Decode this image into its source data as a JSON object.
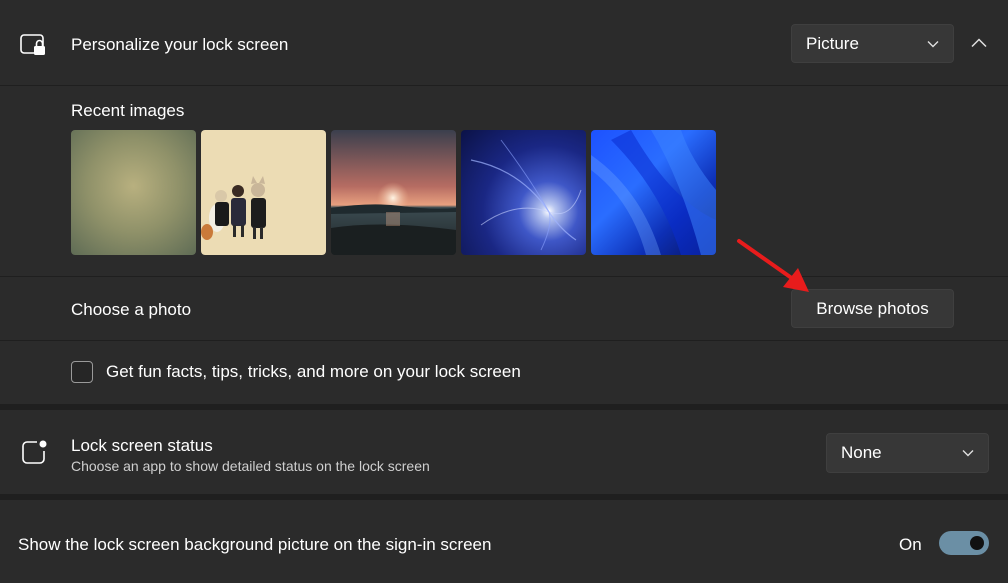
{
  "lock_screen": {
    "title": "Personalize your lock screen",
    "dropdown_value": "Picture",
    "recent_images_label": "Recent images",
    "recent_images": [
      {
        "name": "muted-olive-gradient"
      },
      {
        "name": "cartoon-family"
      },
      {
        "name": "sunset-lake"
      },
      {
        "name": "blue-light-swirl"
      },
      {
        "name": "windows-bloom"
      }
    ],
    "choose_photo_label": "Choose a photo",
    "browse_button_label": "Browse photos",
    "fun_facts_label": "Get fun facts, tips, tricks, and more on your lock screen",
    "fun_facts_checked": false
  },
  "lock_status": {
    "title": "Lock screen status",
    "subtitle": "Choose an app to show detailed status on the lock screen",
    "dropdown_value": "None"
  },
  "signin_background": {
    "label": "Show the lock screen background picture on the sign-in screen",
    "toggle_state": "On"
  },
  "colors": {
    "background": "#1f1f1f",
    "card": "#2b2b2b",
    "control": "#373737",
    "toggle_on": "#6b8fa5",
    "annotation_arrow": "#e81c1c"
  }
}
